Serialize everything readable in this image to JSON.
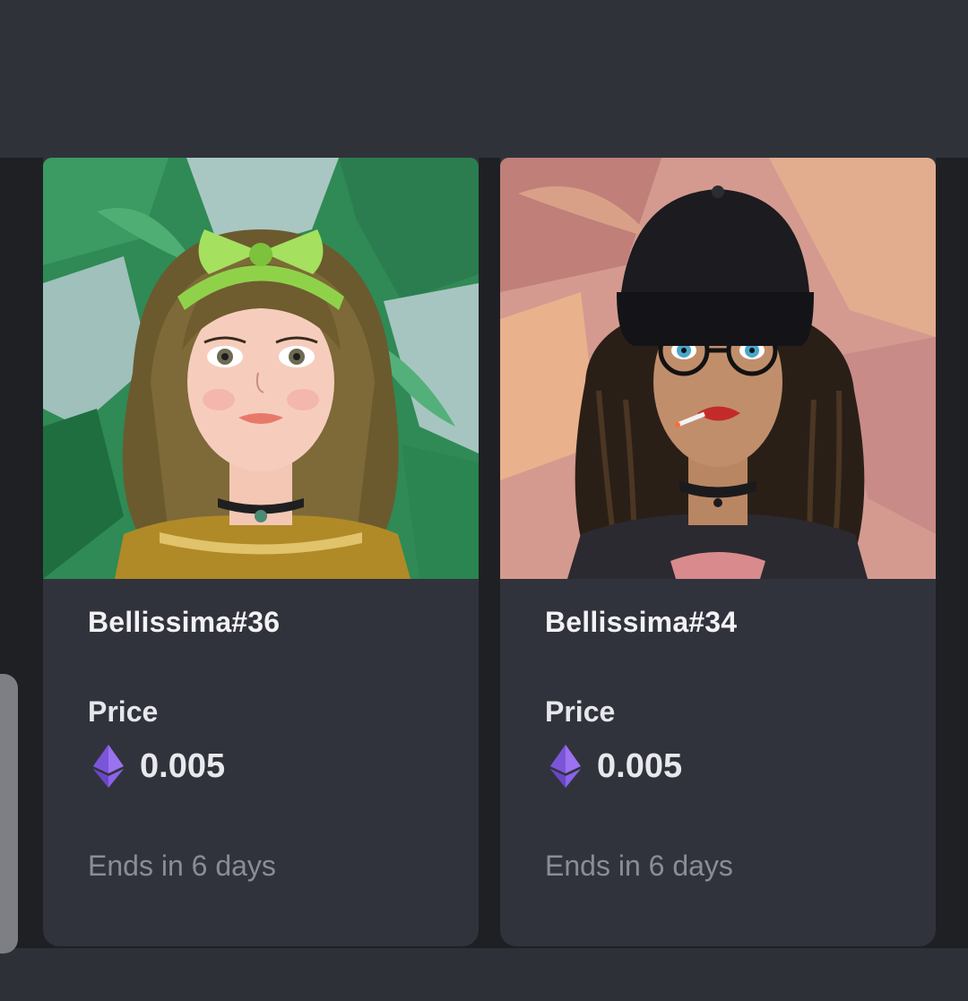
{
  "cards": [
    {
      "name": "Bellissima#36",
      "price_label": "Price",
      "price_icon": "ethereum-icon",
      "price_value": "0.005",
      "ends_text": "Ends in 6 days",
      "image": "nft-portrait-bellissima-36"
    },
    {
      "name": "Bellissima#34",
      "price_label": "Price",
      "price_icon": "ethereum-icon",
      "price_value": "0.005",
      "ends_text": "Ends in 6 days",
      "image": "nft-portrait-bellissima-34"
    }
  ],
  "colors": {
    "background": "#2e2f36",
    "card": "#31333c",
    "name_text": "#f2f2f4",
    "muted_text": "#8b8d94",
    "eth_purple": "#8a63e8"
  }
}
